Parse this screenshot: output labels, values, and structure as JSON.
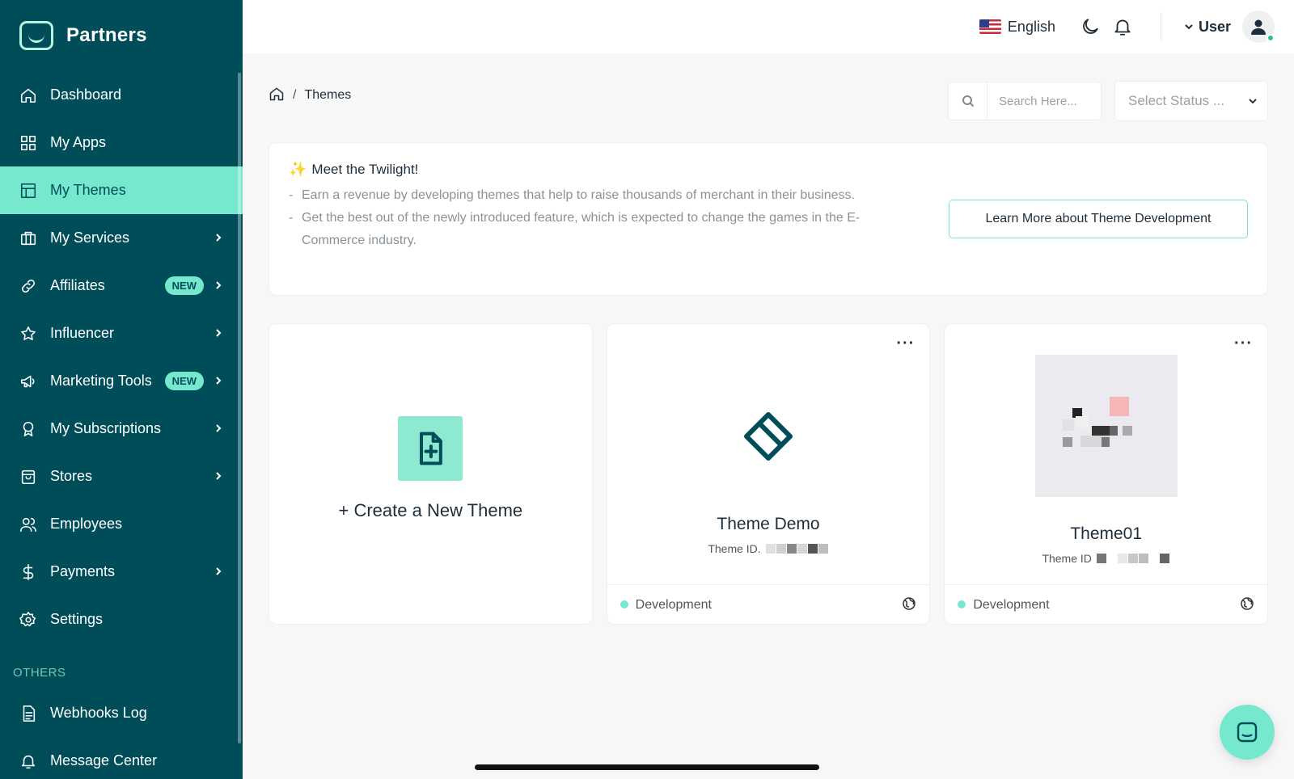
{
  "brand": {
    "name": "Partners"
  },
  "sidebar": {
    "items": [
      {
        "label": "Dashboard",
        "icon": "home-icon",
        "active": false,
        "badge": "",
        "chevron": false
      },
      {
        "label": "My Apps",
        "icon": "grid-icon",
        "active": false,
        "badge": "",
        "chevron": false
      },
      {
        "label": "My Themes",
        "icon": "layout-icon",
        "active": true,
        "badge": "",
        "chevron": false
      },
      {
        "label": "My Services",
        "icon": "briefcase-icon",
        "active": false,
        "badge": "",
        "chevron": true
      },
      {
        "label": "Affiliates",
        "icon": "link-icon",
        "active": false,
        "badge": "NEW",
        "chevron": true
      },
      {
        "label": "Influencer",
        "icon": "star-icon",
        "active": false,
        "badge": "",
        "chevron": true
      },
      {
        "label": "Marketing Tools",
        "icon": "megaphone-icon",
        "active": false,
        "badge": "NEW",
        "chevron": true
      },
      {
        "label": "My Subscriptions",
        "icon": "award-icon",
        "active": false,
        "badge": "",
        "chevron": true
      },
      {
        "label": "Stores",
        "icon": "bag-icon",
        "active": false,
        "badge": "",
        "chevron": true
      },
      {
        "label": "Employees",
        "icon": "users-icon",
        "active": false,
        "badge": "",
        "chevron": false
      },
      {
        "label": "Payments",
        "icon": "dollar-icon",
        "active": false,
        "badge": "",
        "chevron": true
      },
      {
        "label": "Settings",
        "icon": "gear-icon",
        "active": false,
        "badge": "",
        "chevron": false
      }
    ],
    "others_label": "OTHERS",
    "other_items": [
      {
        "label": "Webhooks Log",
        "icon": "document-icon"
      },
      {
        "label": "Message Center",
        "icon": "bell-icon"
      }
    ]
  },
  "topbar": {
    "language": "English",
    "user_label": "User"
  },
  "breadcrumb": {
    "current": "Themes"
  },
  "filters": {
    "search_placeholder": "Search Here...",
    "status_placeholder": "Select Status ..."
  },
  "banner": {
    "title": "Meet the Twilight!",
    "sparkle": "✨",
    "points": [
      "Earn a revenue by developing themes that help to raise thousands of merchant in their business.",
      "Get the best out of the newly introduced feature, which is expected to change the games in the E-Commerce industry."
    ],
    "button_label": "Learn More about Theme Development"
  },
  "cards": {
    "create_label": "+ Create a New Theme",
    "themes": [
      {
        "name": "Theme Demo",
        "id_label": "Theme ID.",
        "status": "Development"
      },
      {
        "name": "Theme01",
        "id_label": "Theme ID",
        "status": "Development"
      }
    ]
  },
  "colors": {
    "sidebar_bg": "#004d5a",
    "accent": "#76e8cd",
    "text": "#1f2d3a"
  }
}
